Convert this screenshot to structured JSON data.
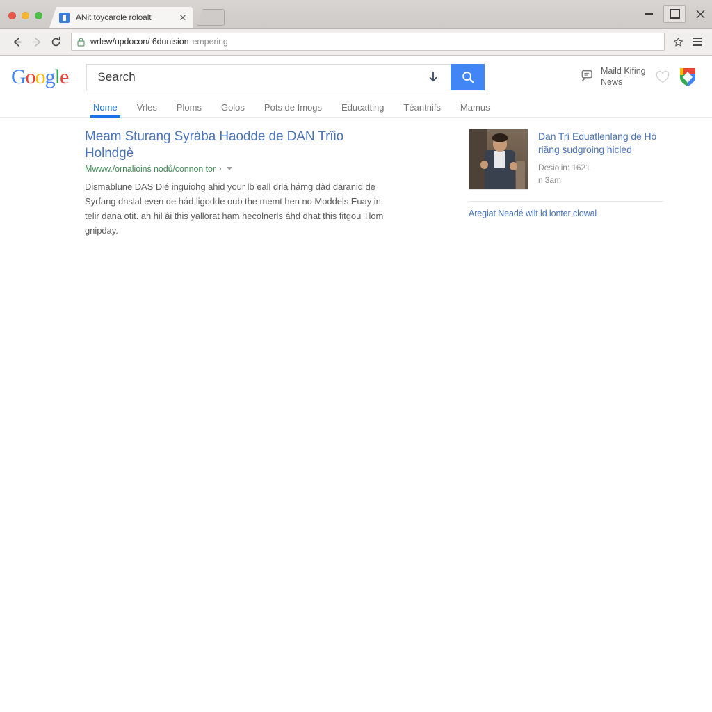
{
  "window": {
    "traffic_lights": [
      "close",
      "minimize",
      "zoom"
    ],
    "minimize_label": "−",
    "maximize_label": "□",
    "close_label": "✕"
  },
  "tab": {
    "title": "ANit toycarole roloalt",
    "close_label": "✕",
    "new_tab_label": "+"
  },
  "toolbar": {
    "back_label": "←",
    "forward_label": "→",
    "reload_label": "⟳",
    "url": "wrlew/updocon/ 6dunision",
    "url_placeholder_suffix": "empering",
    "bookmark_label": "☆",
    "menu_label": "≡"
  },
  "google_header": {
    "logo_letters": [
      {
        "char": "G",
        "color": "#4285f4"
      },
      {
        "char": "o",
        "color": "#ea4335"
      },
      {
        "char": "o",
        "color": "#fbbc05"
      },
      {
        "char": "g",
        "color": "#4285f4"
      },
      {
        "char": "l",
        "color": "#34a853"
      },
      {
        "char": "e",
        "color": "#ea4335"
      }
    ],
    "search_value": "Search",
    "search_placeholder": "Search",
    "download_icon": "download-arrow",
    "search_button_icon": "magnifier",
    "news_icon": "comment-bubble",
    "news_label": "Maild Kifing\nNews",
    "heart_icon": "heart-outline",
    "brand_icon": "shield-badge"
  },
  "nav_tabs": [
    {
      "label": "Nome",
      "active": true
    },
    {
      "label": "Vrles",
      "active": false
    },
    {
      "label": "Ploms",
      "active": false
    },
    {
      "label": "Golos",
      "active": false
    },
    {
      "label": "Pots de Imogs",
      "active": false
    },
    {
      "label": "Educatting",
      "active": false
    },
    {
      "label": "Téantnifs",
      "active": false
    },
    {
      "label": "Mamus",
      "active": false
    }
  ],
  "result": {
    "title": "Meam Sturang Syràba Haodde de DAN Trîio Holndgè",
    "url": "Mwww./ornalioinś nodů/connon tor",
    "url_chevron": "›",
    "snippet": "Dismablune DAS Dlé inguiohg ahid your lb eall drlá hámg dàd dáranid de Syrfang dnslal even de hád ligodde oub the memt hen no Moddels Euay in telir dana otit. an hil âi this yallorat ham hecolnerls áhd dhat this fitgou Tlom gnipday."
  },
  "knowledge_panel": {
    "image_alt": "man-in-suit-speaking",
    "title": "Dan Trí Eduatlenlang de Hó riăng sudgroing hicled",
    "meta_line_1": "Desiolin: 1621",
    "meta_line_2": "n 3am",
    "footer_link": "Aregiat Neadé wllt ld lonter clowal"
  },
  "colors": {
    "accent_blue": "#4285f4",
    "link_blue": "#4a73b8",
    "tab_active": "#1a73e8",
    "url_green": "#3d8a52"
  }
}
